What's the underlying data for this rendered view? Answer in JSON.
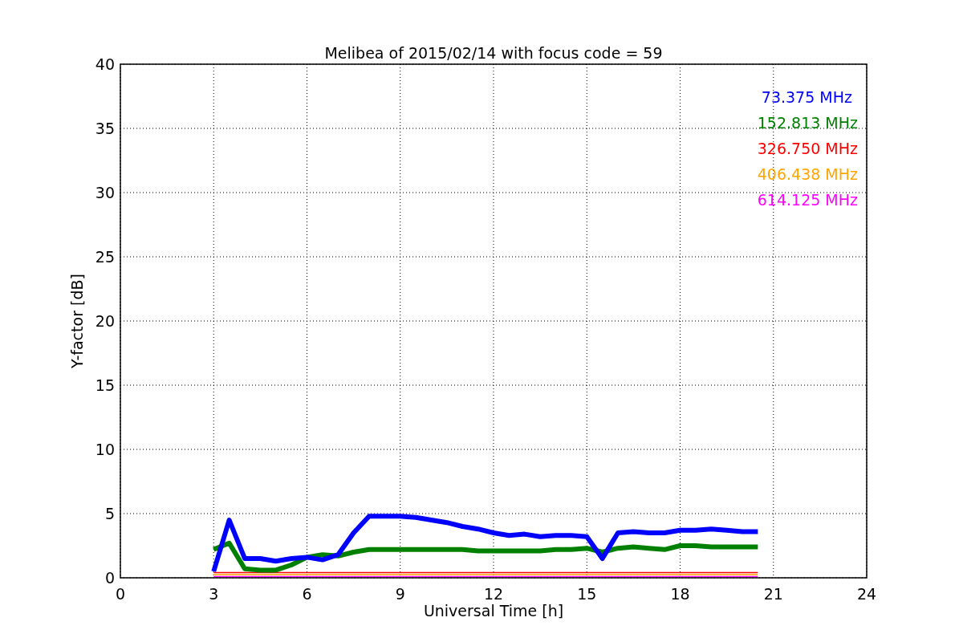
{
  "chart_data": {
    "type": "line",
    "title": "Melibea of 2015/02/14 with focus code = 59",
    "xlabel": "Universal Time [h]",
    "ylabel": "Y-factor [dB]",
    "x": [
      3,
      3.5,
      4,
      4.5,
      5,
      5.5,
      6,
      6.5,
      7,
      7.5,
      8,
      8.5,
      9,
      9.5,
      10,
      10.5,
      11,
      11.5,
      12,
      12.5,
      13,
      13.5,
      14,
      14.5,
      15,
      15.5,
      16,
      16.5,
      17,
      17.5,
      18,
      18.5,
      19,
      19.5,
      20,
      20.5
    ],
    "series": [
      {
        "name": "73.375 MHz",
        "color": "#0000ff",
        "values": [
          0.5,
          4.5,
          1.5,
          1.5,
          1.3,
          1.5,
          1.6,
          1.4,
          1.8,
          3.5,
          4.8,
          4.8,
          4.8,
          4.7,
          4.5,
          4.3,
          4.0,
          3.8,
          3.5,
          3.3,
          3.4,
          3.2,
          3.3,
          3.3,
          3.2,
          1.5,
          3.5,
          3.6,
          3.5,
          3.5,
          3.7,
          3.7,
          3.8,
          3.7,
          3.6,
          3.6
        ]
      },
      {
        "name": "152.813 MHz",
        "color": "#008000",
        "values": [
          2.2,
          2.7,
          0.7,
          0.6,
          0.6,
          1.0,
          1.6,
          1.8,
          1.7,
          2.0,
          2.2,
          2.2,
          2.2,
          2.2,
          2.2,
          2.2,
          2.2,
          2.1,
          2.1,
          2.1,
          2.1,
          2.1,
          2.2,
          2.2,
          2.3,
          2.0,
          2.3,
          2.4,
          2.3,
          2.2,
          2.5,
          2.5,
          2.4,
          2.4,
          2.4,
          2.4
        ]
      },
      {
        "name": "326.750 MHz",
        "color": "#ff0000",
        "values": [
          0.4,
          0.4,
          0.4,
          0.4,
          0.4,
          0.4,
          0.4,
          0.4,
          0.4,
          0.4,
          0.4,
          0.4,
          0.4,
          0.4,
          0.4,
          0.4,
          0.4,
          0.4,
          0.4,
          0.4,
          0.4,
          0.4,
          0.4,
          0.4,
          0.4,
          0.4,
          0.4,
          0.4,
          0.4,
          0.4,
          0.4,
          0.4,
          0.4,
          0.4,
          0.4,
          0.4
        ]
      },
      {
        "name": "406.438 MHz",
        "color": "#ffa500",
        "values": [
          0.25,
          0.25,
          0.25,
          0.25,
          0.25,
          0.25,
          0.25,
          0.25,
          0.25,
          0.25,
          0.25,
          0.25,
          0.25,
          0.25,
          0.25,
          0.25,
          0.25,
          0.25,
          0.25,
          0.25,
          0.25,
          0.25,
          0.25,
          0.25,
          0.25,
          0.25,
          0.25,
          0.25,
          0.25,
          0.25,
          0.25,
          0.25,
          0.25,
          0.25,
          0.25,
          0.25
        ]
      },
      {
        "name": "614.125 MHz",
        "color": "#ff00ff",
        "values": [
          0.1,
          0.1,
          0.1,
          0.1,
          0.1,
          0.1,
          0.1,
          0.1,
          0.1,
          0.1,
          0.1,
          0.1,
          0.1,
          0.1,
          0.1,
          0.1,
          0.1,
          0.1,
          0.1,
          0.1,
          0.1,
          0.1,
          0.1,
          0.1,
          0.1,
          0.1,
          0.1,
          0.1,
          0.1,
          0.1,
          0.1,
          0.1,
          0.1,
          0.1,
          0.1,
          0.1
        ]
      }
    ],
    "grid": true,
    "xlim": [
      0,
      24
    ],
    "ylim": [
      0,
      40
    ],
    "xticks": [
      0,
      3,
      6,
      9,
      12,
      15,
      18,
      21,
      24
    ],
    "yticks": [
      0,
      5,
      10,
      15,
      20,
      25,
      30,
      35,
      40
    ]
  }
}
